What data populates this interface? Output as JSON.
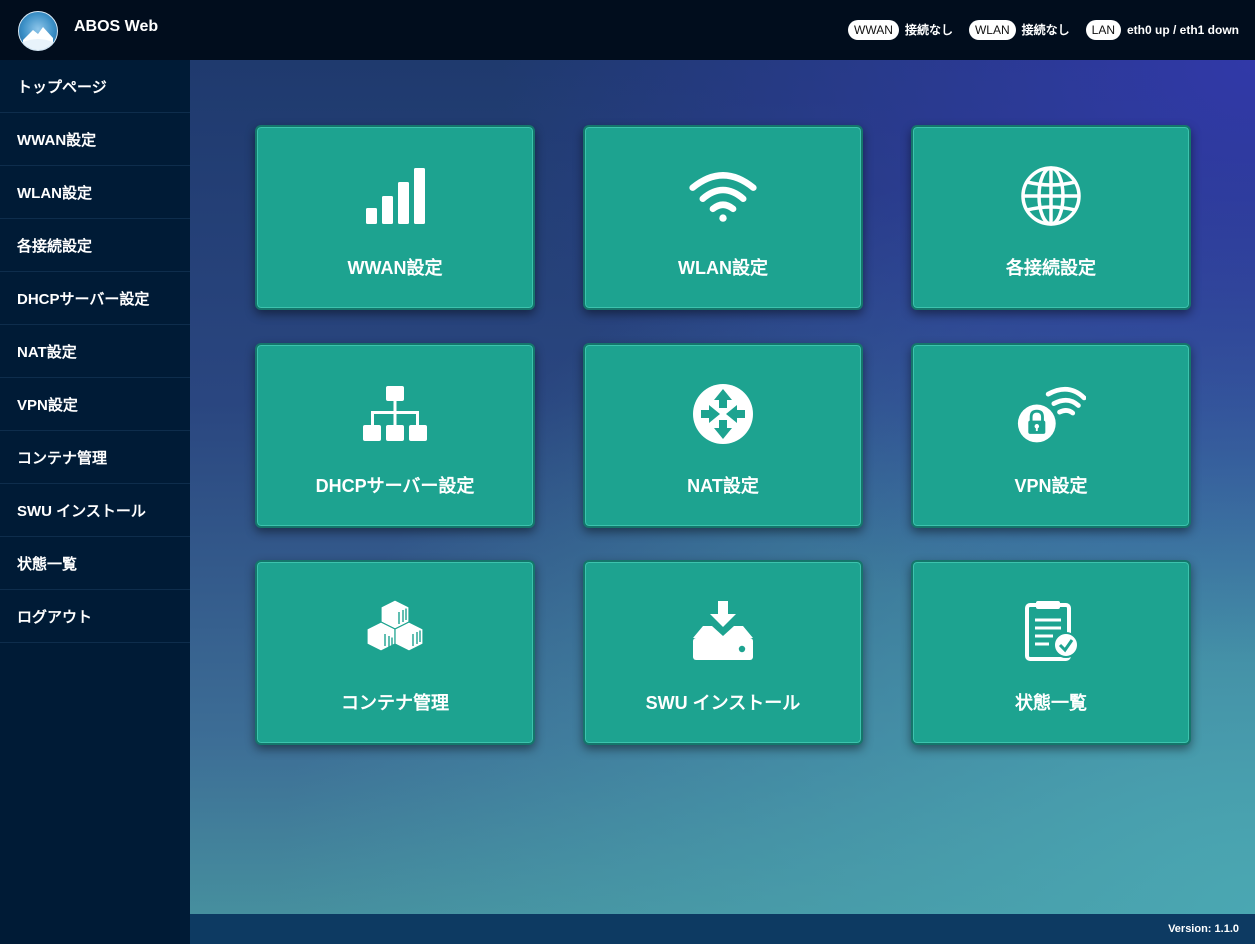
{
  "header": {
    "app_title": "ABOS Web",
    "status": [
      {
        "badge": "WWAN",
        "text": "接続なし"
      },
      {
        "badge": "WLAN",
        "text": "接続なし"
      },
      {
        "badge": "LAN",
        "text": "eth0 up / eth1 down"
      }
    ]
  },
  "sidebar": {
    "items": [
      {
        "label": "トップページ"
      },
      {
        "label": "WWAN設定"
      },
      {
        "label": "WLAN設定"
      },
      {
        "label": "各接続設定"
      },
      {
        "label": "DHCPサーバー設定"
      },
      {
        "label": "NAT設定"
      },
      {
        "label": "VPN設定"
      },
      {
        "label": "コンテナ管理"
      },
      {
        "label": "SWU インストール"
      },
      {
        "label": "状態一覧"
      },
      {
        "label": "ログアウト"
      }
    ]
  },
  "tiles": [
    {
      "label": "WWAN設定",
      "icon": "signal-bars-icon"
    },
    {
      "label": "WLAN設定",
      "icon": "wifi-icon"
    },
    {
      "label": "各接続設定",
      "icon": "globe-icon"
    },
    {
      "label": "DHCPサーバー設定",
      "icon": "network-tree-icon"
    },
    {
      "label": "NAT設定",
      "icon": "router-arrows-icon"
    },
    {
      "label": "VPN設定",
      "icon": "lock-wifi-icon"
    },
    {
      "label": "コンテナ管理",
      "icon": "containers-icon"
    },
    {
      "label": "SWU インストール",
      "icon": "download-drive-icon"
    },
    {
      "label": "状態一覧",
      "icon": "clipboard-check-icon"
    }
  ],
  "footer": {
    "version": "Version: 1.1.0"
  },
  "colors": {
    "tile": "#1da390",
    "sidebar": "#001b36",
    "topbar": "#010d1d",
    "footer": "#0d3a62"
  }
}
